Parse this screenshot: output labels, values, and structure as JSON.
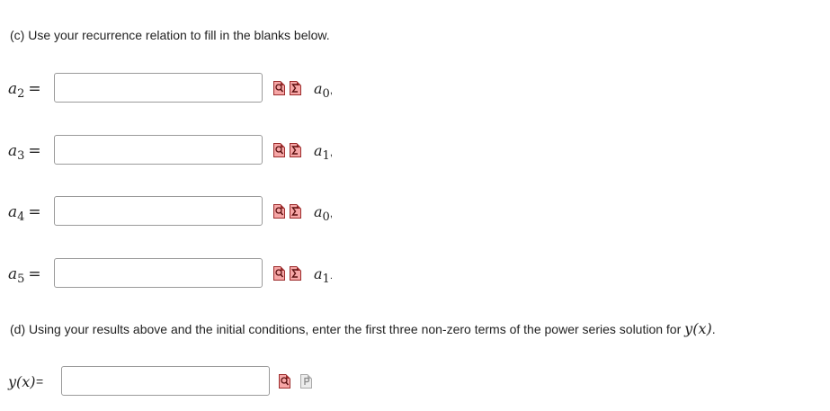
{
  "part_c": {
    "text": "(c) Use your recurrence relation to fill in the blanks below."
  },
  "rows": [
    {
      "lhs_var": "a",
      "lhs_sub": "2",
      "equals": "=",
      "value": "",
      "rhs_var": "a",
      "rhs_sub": "0",
      "punct": ","
    },
    {
      "lhs_var": "a",
      "lhs_sub": "3",
      "equals": "=",
      "value": "",
      "rhs_var": "a",
      "rhs_sub": "1",
      "punct": ","
    },
    {
      "lhs_var": "a",
      "lhs_sub": "4",
      "equals": "=",
      "value": "",
      "rhs_var": "a",
      "rhs_sub": "0",
      "punct": ","
    },
    {
      "lhs_var": "a",
      "lhs_sub": "5",
      "equals": "=",
      "value": "",
      "rhs_var": "a",
      "rhs_sub": "1",
      "punct": "."
    }
  ],
  "part_d": {
    "text": "(d) Using your results above and the initial conditions, enter the first three non-zero terms of the power series solution for",
    "expr": "y(x)",
    "end": "."
  },
  "final": {
    "lhs": "y(x)",
    "equals": "=",
    "value": ""
  },
  "icons": {
    "preview": "preview-icon",
    "equation_editor": "equation-editor-icon",
    "preview_disabled": "preview-disabled-icon",
    "color_active": "#f6a6a6",
    "color_disabled": "#ececec"
  }
}
